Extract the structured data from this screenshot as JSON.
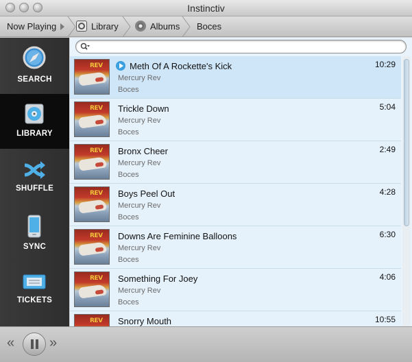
{
  "window": {
    "title": "Instinctiv"
  },
  "breadcrumb": {
    "now_playing": "Now Playing",
    "library": "Library",
    "albums": "Albums",
    "current": "Boces"
  },
  "sidebar": {
    "items": [
      {
        "label": "SEARCH",
        "icon": "compass-icon"
      },
      {
        "label": "LIBRARY",
        "icon": "cd-icon"
      },
      {
        "label": "SHUFFLE",
        "icon": "shuffle-icon"
      },
      {
        "label": "SYNC",
        "icon": "ipod-icon"
      },
      {
        "label": "TICKETS",
        "icon": "ticket-icon"
      }
    ],
    "active": "LIBRARY"
  },
  "search": {
    "value": "",
    "placeholder": ""
  },
  "tracks": [
    {
      "title": "Meth Of A Rockette's Kick",
      "artist": "Mercury Rev",
      "album": "Boces",
      "duration": "10:29",
      "playing": true
    },
    {
      "title": "Trickle Down",
      "artist": "Mercury Rev",
      "album": "Boces",
      "duration": "5:04"
    },
    {
      "title": "Bronx Cheer",
      "artist": "Mercury Rev",
      "album": "Boces",
      "duration": "2:49"
    },
    {
      "title": "Boys Peel Out",
      "artist": "Mercury Rev",
      "album": "Boces",
      "duration": "4:28"
    },
    {
      "title": "Downs Are Feminine Balloons",
      "artist": "Mercury Rev",
      "album": "Boces",
      "duration": "6:30"
    },
    {
      "title": "Something For Joey",
      "artist": "Mercury Rev",
      "album": "Boces",
      "duration": "4:06"
    },
    {
      "title": "Snorry Mouth",
      "artist": "",
      "album": "",
      "duration": "10:55"
    }
  ],
  "album_art_text": "REV",
  "controls": {
    "prev": "«",
    "next": "»"
  },
  "colors": {
    "accent": "#3aa0df",
    "sidebar_active": "#0c0c0c",
    "selected_row": "#cfe6f8"
  }
}
